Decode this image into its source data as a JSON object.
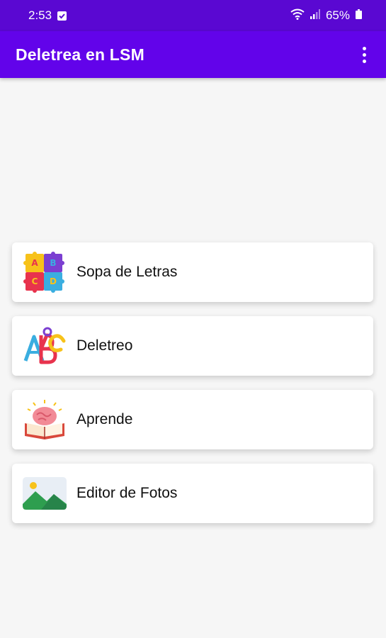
{
  "status_bar": {
    "time": "2:53",
    "battery": "65%",
    "icons": [
      "notification-check-icon",
      "wifi-icon",
      "signal-icon",
      "battery-icon"
    ]
  },
  "app_bar": {
    "title": "Deletrea en LSM",
    "menu_icon": "more-vert-icon"
  },
  "menu": {
    "items": [
      {
        "label": "Sopa de Letras",
        "icon": "letter-blocks-icon"
      },
      {
        "label": "Deletreo",
        "icon": "abc-letters-icon"
      },
      {
        "label": "Aprende",
        "icon": "brain-book-icon"
      },
      {
        "label": "Editor de Fotos",
        "icon": "image-landscape-icon"
      }
    ]
  },
  "colors": {
    "status_bar": "#5a08d2",
    "app_bar": "#6203ea",
    "background": "#f6f6f6",
    "card": "#ffffff"
  }
}
